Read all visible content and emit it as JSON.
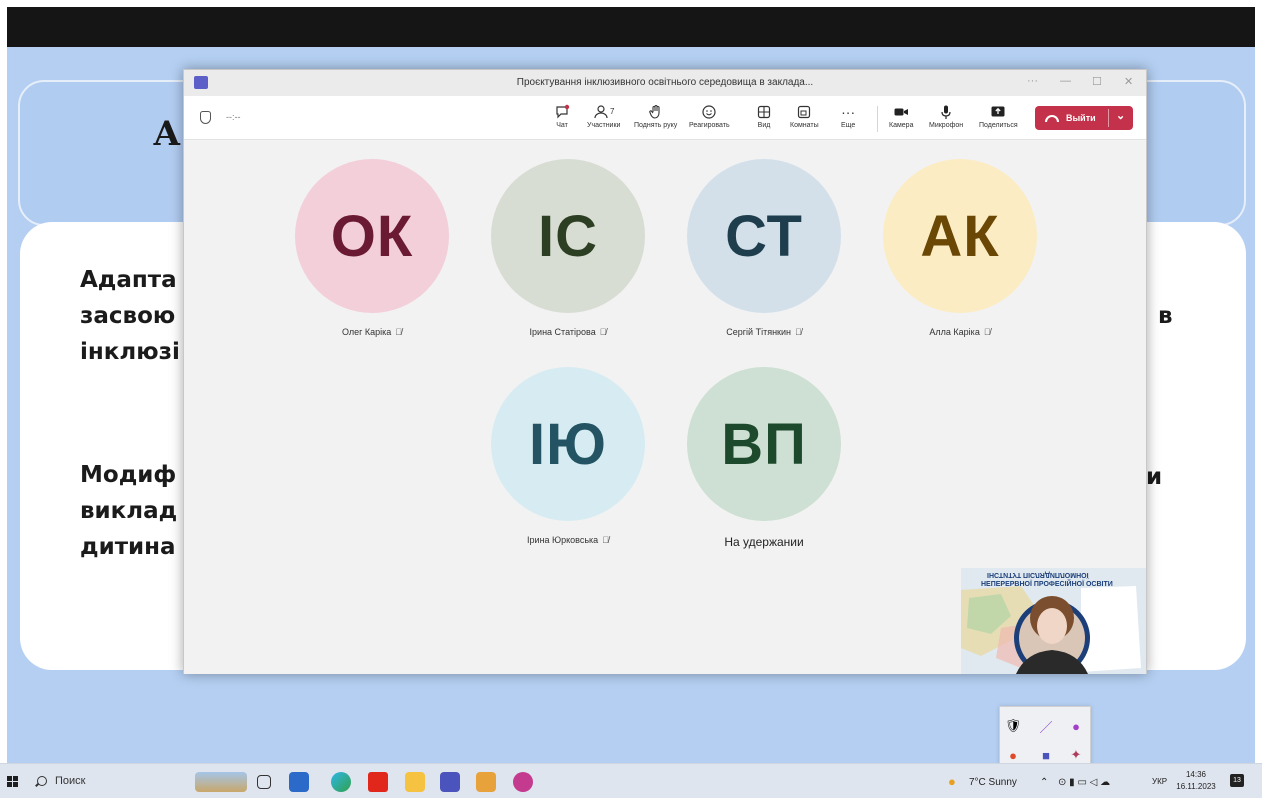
{
  "slide": {
    "title_fragment": "А",
    "lines_left": [
      "Адапта",
      "засвою",
      "інклюзі"
    ],
    "line_right_1": "в",
    "lines_left_2": [
      "Модиф",
      "виклад",
      "дитина"
    ],
    "line_right_2": "и"
  },
  "window": {
    "title": "Проєктування інклюзивного освітнього середовища в заклада...",
    "ellipsis": "···",
    "timer": "--:--"
  },
  "toolbar": {
    "chat_label": "Чат",
    "participants_label": "Участники",
    "participants_count": "7",
    "raise_hand_label": "Поднять руку",
    "react_label": "Реагировать",
    "view_label": "Вид",
    "rooms_label": "Комнаты",
    "more_label": "Еще",
    "camera_label": "Камера",
    "mic_label": "Микрофон",
    "share_label": "Поделиться",
    "leave_label": "Выйти"
  },
  "participants": [
    {
      "initials": "ОК",
      "name": "Олег Каріка",
      "bg": "#f2cfd9",
      "fg": "#6b1a33"
    },
    {
      "initials": "ІС",
      "name": "Ірина Статірова",
      "bg": "#d8ddd4",
      "fg": "#2d3f22"
    },
    {
      "initials": "СТ",
      "name": "Сергій Тітянкин",
      "bg": "#d3e0ea",
      "fg": "#1e3e4d"
    },
    {
      "initials": "АК",
      "name": "Алла Каріка",
      "bg": "#fbecc3",
      "fg": "#6a4705"
    },
    {
      "initials": "ІЮ",
      "name": "Ірина Юрковська",
      "bg": "#d6ecf2",
      "fg": "#245463"
    },
    {
      "initials": "ВП",
      "name": "На удержании",
      "bg": "#cde0d3",
      "fg": "#1d4a2c"
    }
  ],
  "selfview": {
    "header_line1": "НЕПЕРЕРВНОЇ ПРОФЕСІЙНОЇ ОСВІТИ",
    "header_mirror": "ІНСТИТУТ ПІСЛЯДИПЛОМНОЇ"
  },
  "taskbar": {
    "search_label": "Поиск",
    "weather": "7°C  Sunny",
    "lang": "УКР",
    "time": "14:36",
    "date": "16.11.2023",
    "notif_count": "13"
  }
}
